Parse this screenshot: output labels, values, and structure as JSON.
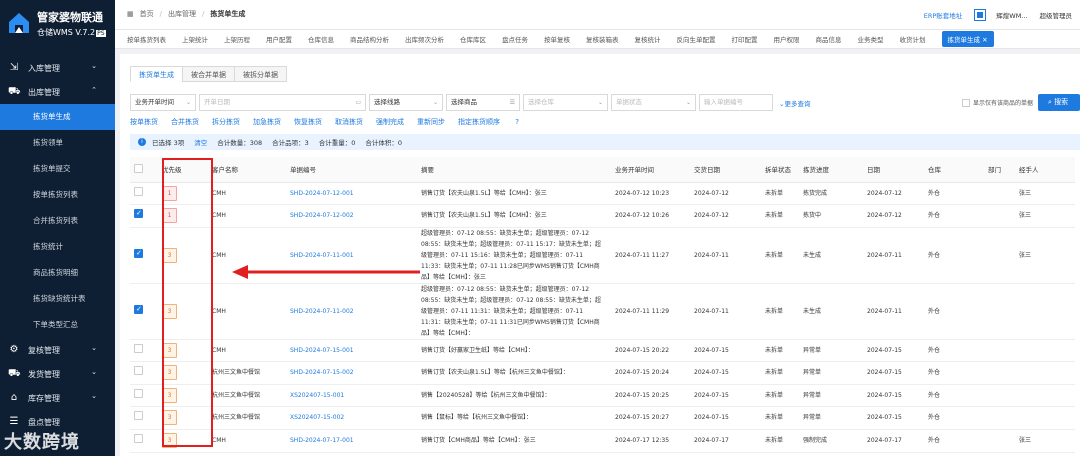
{
  "app": {
    "title_line1": "管家婆物联通",
    "title_line2": "仓储WMS V.7.2",
    "version_badge": "PS"
  },
  "sidebar": {
    "groups": [
      {
        "label": "入库管理",
        "icon": "inbound-icon",
        "chev": "⌄"
      },
      {
        "label": "出库管理",
        "icon": "outbound-icon",
        "chev": "⌃"
      }
    ],
    "items": [
      "拣货单生成",
      "拣货领单",
      "拣货单提交",
      "按单拣货列表",
      "合并拣货列表",
      "拣货统计",
      "商品拣货明细",
      "拣货缺货统计表",
      "下单类型汇总"
    ],
    "bottom_groups": [
      {
        "label": "复核管理",
        "chev": "⌄"
      },
      {
        "label": "发货管理",
        "chev": "⌄"
      },
      {
        "label": "库存管理",
        "chev": "⌄"
      },
      {
        "label": "盘点管理",
        "chev": "⌄"
      }
    ]
  },
  "breadcrumb": {
    "home": "首页",
    "sep": "/",
    "parent": "出库管理",
    "current": "拣货单生成"
  },
  "topright": {
    "erp": "ERP账套地址",
    "user": "辉煌WM...",
    "role": "超级管理员"
  },
  "tabs": [
    "按单拣货列表",
    "上架统计",
    "上架历程",
    "用户配置",
    "仓库信息",
    "商品结构分析",
    "出库频次分析",
    "仓库库区",
    "盘点任务",
    "按单复核",
    "复核装箱表",
    "复核统计",
    "反向生单配置",
    "打印配置",
    "用户权限",
    "商品信息",
    "业务类型",
    "收货计划",
    "拣货单生成 ✕"
  ],
  "subtabs": [
    "拣货单生成",
    "被合并单据",
    "被拆分单据"
  ],
  "filters": {
    "time_type": "业务开单时间",
    "date": "开单日期",
    "route": "选择线路",
    "goods": "选择商品",
    "warehouse": "选择仓库",
    "status": "单据状态",
    "bill_no": "输入单据编号",
    "more": "更多查询",
    "show_only": "显示仅有该商品的单据",
    "search": "搜索"
  },
  "actions": [
    "按单拣货",
    "合并拣货",
    "拆分拣货",
    "加急拣货",
    "恢复拣货",
    "取消拣货",
    "强制完成",
    "重新同步",
    "指定拣货顺序"
  ],
  "summary": {
    "selected": "已选择 3项",
    "clear": "清空",
    "qty": "合计数量：308",
    "items": "合计品项：3",
    "weight": "合计重量：0",
    "volume": "合计体积：0"
  },
  "table": {
    "columns": [
      "",
      "优先级",
      "客户名称",
      "单据编号",
      "摘要",
      "业务开单时间",
      "交货日期",
      "拆单状态",
      "拣货进度",
      "日期",
      "仓库",
      "部门",
      "经手人"
    ],
    "rows": [
      {
        "checked": false,
        "prio": "1",
        "red": true,
        "cust": "CMH",
        "no": "SHD-2024-07-12-001",
        "summary": "销售订货【农夫山泉1.5L】等给【CMH】：张三",
        "time": "2024-07-12 10:23",
        "delivery": "2024-07-12",
        "split": "未拆单",
        "progress": "拣货完成",
        "date": "2024-07-12",
        "wh": "外仓",
        "dept": "",
        "handler": "张三"
      },
      {
        "checked": true,
        "prio": "1",
        "red": true,
        "cust": "CMH",
        "no": "SHD-2024-07-12-002",
        "summary": "销售订货【农夫山泉1.5L】等给【CMH】：张三",
        "time": "2024-07-12 10:26",
        "delivery": "2024-07-12",
        "split": "未拆单",
        "progress": "拣货中",
        "date": "2024-07-12",
        "wh": "外仓",
        "dept": "",
        "handler": "张三"
      },
      {
        "checked": true,
        "prio": "3",
        "red": false,
        "cust": "CMH",
        "no": "SHD-2024-07-11-001",
        "summary": "超级管理员：07-12 08:55：缺货未生单；超级管理员：07-12 08:55：缺货未生单；超级管理员：07-11 15:17：缺货未生单；超级管理员：07-11 15:16：缺货未生单；超级管理员：07-11 11:33：缺货未生单；07-11 11:28已同步WMS销售订货【CMH商品】等给【CMH】：张三",
        "time": "2024-07-11 11:27",
        "delivery": "2024-07-11",
        "split": "未拆单",
        "progress": "未生成",
        "date": "2024-07-11",
        "wh": "外仓",
        "dept": "",
        "handler": "张三"
      },
      {
        "checked": true,
        "prio": "3",
        "red": false,
        "cust": "CMH",
        "no": "SHD-2024-07-11-002",
        "summary": "超级管理员：07-12 08:55：缺货未生单；超级管理员：07-12 08:55：缺货未生单；超级管理员：07-12 08:55：缺货未生单；超级管理员：07-11 11:31：缺货未生单；超级管理员：07-11 11:31：缺货未生单；07-11 11:31已同步WMS销售订货【CMH商品】等给【CMH】：",
        "time": "2024-07-11 11:29",
        "delivery": "2024-07-11",
        "split": "未拆单",
        "progress": "未生成",
        "date": "2024-07-11",
        "wh": "外仓",
        "dept": "",
        "handler": ""
      },
      {
        "checked": false,
        "prio": "3",
        "red": false,
        "cust": "CMH",
        "no": "SHD-2024-07-15-001",
        "summary": "销售订货【好赢家卫生纸】等给【CMH】：",
        "time": "2024-07-15 20:22",
        "delivery": "2024-07-15",
        "split": "未拆单",
        "progress": "异常单",
        "date": "2024-07-15",
        "wh": "外仓",
        "dept": "",
        "handler": ""
      },
      {
        "checked": false,
        "prio": "3",
        "red": false,
        "cust": "杭州三文鱼中餐馆",
        "no": "SHD-2024-07-15-002",
        "summary": "销售订货【农夫山泉1.5L】等给【杭州三文鱼中餐馆】：",
        "time": "2024-07-15 20:24",
        "delivery": "2024-07-15",
        "split": "未拆单",
        "progress": "异常单",
        "date": "2024-07-15",
        "wh": "外仓",
        "dept": "",
        "handler": ""
      },
      {
        "checked": false,
        "prio": "3",
        "red": false,
        "cust": "杭州三文鱼中餐馆",
        "no": "XS202407-15-001",
        "summary": "销售【20240528】等给【杭州三文鱼中餐馆】：",
        "time": "2024-07-15 20:25",
        "delivery": "2024-07-15",
        "split": "未拆单",
        "progress": "异常单",
        "date": "2024-07-15",
        "wh": "外仓",
        "dept": "",
        "handler": ""
      },
      {
        "checked": false,
        "prio": "3",
        "red": false,
        "cust": "杭州三文鱼中餐馆",
        "no": "XS202407-15-002",
        "summary": "销售【鼠标】等给【杭州三文鱼中餐馆】：",
        "time": "2024-07-15 20:27",
        "delivery": "2024-07-15",
        "split": "未拆单",
        "progress": "异常单",
        "date": "2024-07-15",
        "wh": "外仓",
        "dept": "",
        "handler": ""
      },
      {
        "checked": false,
        "prio": "3",
        "red": false,
        "cust": "CMH",
        "no": "SHD-2024-07-17-001",
        "summary": "销售订货【CMH商品】等给【CMH】：张三",
        "time": "2024-07-17 12:35",
        "delivery": "2024-07-17",
        "split": "未拆单",
        "progress": "强制完成",
        "date": "2024-07-17",
        "wh": "外仓",
        "dept": "",
        "handler": "张三"
      }
    ]
  },
  "watermark": "大数跨境",
  "colors": {
    "accent": "#1f7ae0",
    "sidebar": "#0f1f33",
    "highlight": "#e02020"
  }
}
